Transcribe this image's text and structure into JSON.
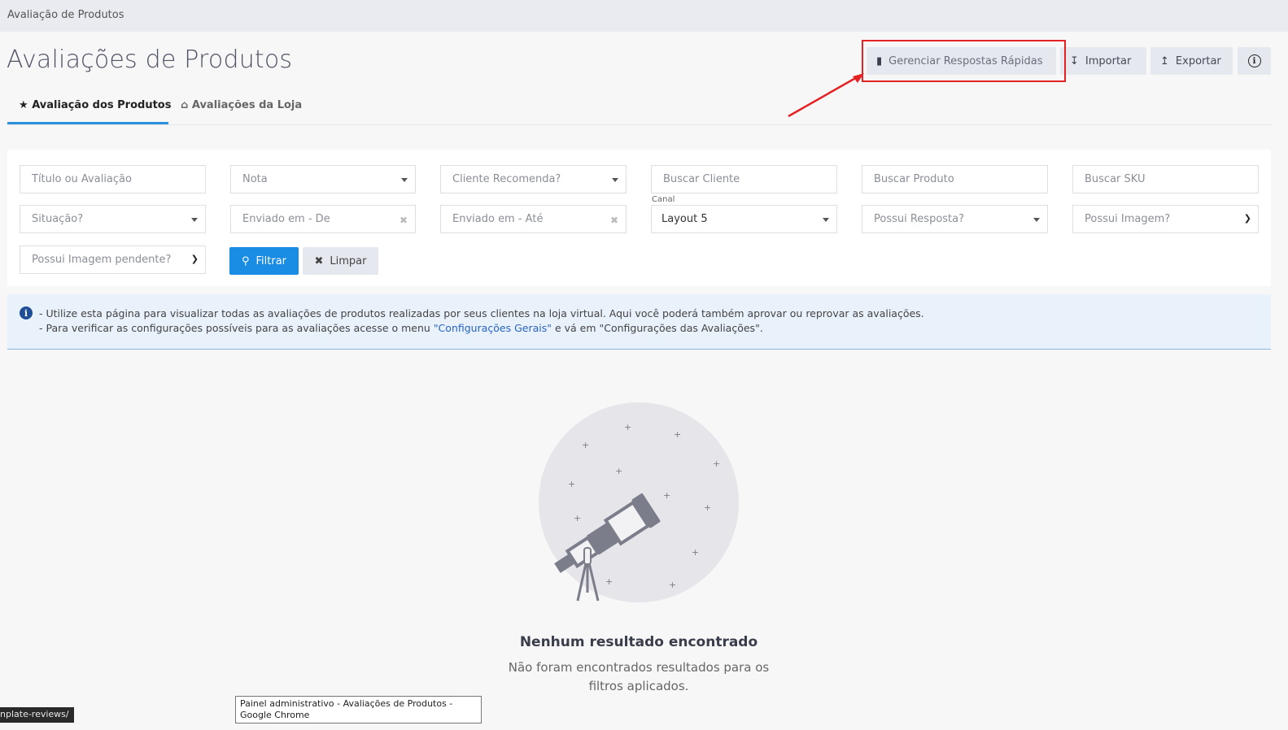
{
  "topbar": {
    "breadcrumb": "Avaliação de Produtos"
  },
  "header": {
    "title": "Avaliações de Produtos",
    "buttons": {
      "gerenciar": "Gerenciar Respostas Rápidas",
      "importar": "Importar",
      "exportar": "Exportar"
    }
  },
  "tabs": [
    {
      "label": "Avaliação dos Produtos",
      "icon": "star-icon",
      "active": true
    },
    {
      "label": "Avaliações da Loja",
      "icon": "home-icon",
      "active": false
    }
  ],
  "filters": {
    "titulo": {
      "placeholder": "Título ou Avaliação"
    },
    "nota": {
      "placeholder": "Nota"
    },
    "cliente_recomenda": {
      "placeholder": "Cliente Recomenda?"
    },
    "buscar_cliente": {
      "placeholder": "Buscar Cliente"
    },
    "buscar_produto": {
      "placeholder": "Buscar Produto"
    },
    "buscar_sku": {
      "placeholder": "Buscar SKU"
    },
    "situacao": {
      "placeholder": "Situação?"
    },
    "enviado_de": {
      "placeholder": "Enviado em - De"
    },
    "enviado_ate": {
      "placeholder": "Enviado em - Até"
    },
    "canal": {
      "label": "Canal",
      "value": "Layout 5"
    },
    "possui_resposta": {
      "placeholder": "Possui Resposta?"
    },
    "possui_imagem": {
      "placeholder": "Possui Imagem?"
    },
    "imagem_pendente": {
      "placeholder": "Possui Imagem pendente?"
    },
    "filtrar_label": "Filtrar",
    "limpar_label": "Limpar"
  },
  "info": {
    "line1": "- Utilize esta página para visualizar todas as avaliações de produtos realizadas por seus clientes na loja virtual. Aqui você poderá também aprovar ou reprovar as avaliações.",
    "line2_pre": "- Para verificar as configurações possíveis para as avaliações acesse o menu ",
    "line2_link": "\"Configurações Gerais\"",
    "line2_post": " e vá em \"Configurações das Avaliações\"."
  },
  "empty": {
    "title": "Nenhum resultado encontrado",
    "subtitle": "Não foram encontrados resultados para os filtros aplicados."
  },
  "browser": {
    "status_url": "nplate-reviews/",
    "tooltip": "Painel administrativo - Avaliações de Produtos - Google Chrome"
  },
  "colors": {
    "accent": "#198ce4",
    "highlight": "#e52222",
    "info_bg": "#e9f1fb"
  }
}
